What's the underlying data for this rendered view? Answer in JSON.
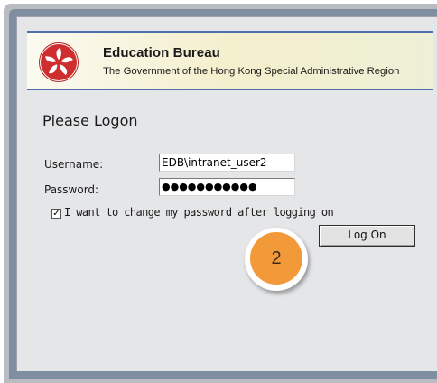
{
  "banner": {
    "org_name": "Education Bureau",
    "org_subtitle": "The Government of the Hong Kong Special Administrative Region",
    "emblem_icon": "hong-kong-bauhinia-emblem"
  },
  "form": {
    "heading": "Please Logon",
    "username_label": "Username:",
    "username_value": "EDB\\intranet_user2",
    "password_label": "Password:",
    "password_masked": "●●●●●●●●●●●",
    "change_password_checked": true,
    "change_password_label": "I want to change my password after logging on",
    "logon_button": "Log On"
  },
  "step_badge": {
    "number": "2",
    "color": "#f29a39"
  },
  "colors": {
    "window_frame": "#7f8ea0",
    "banner_border": "#4f6fab",
    "panel": "#e5e6e8"
  }
}
